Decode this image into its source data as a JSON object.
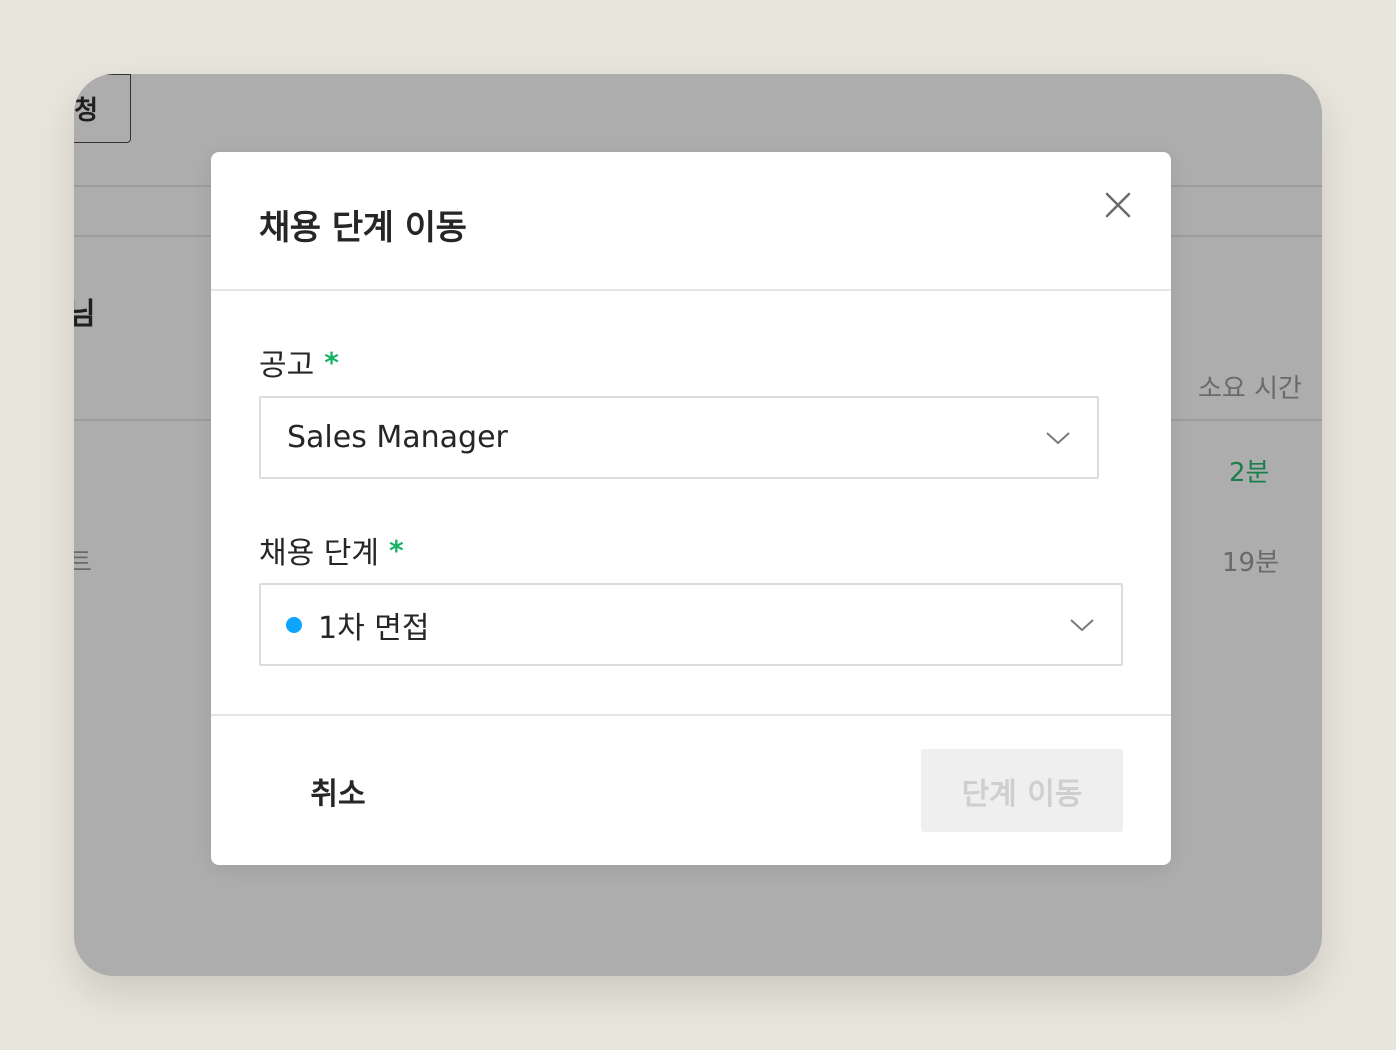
{
  "background": {
    "tab_fragment": "청",
    "heading_fragment": "님",
    "row_fragment": "트",
    "column_header": "소요 시간",
    "rows": [
      {
        "duration": "2분",
        "color": "#1b7f4c"
      },
      {
        "duration": "19분",
        "color": "#6a6a6a"
      }
    ]
  },
  "modal": {
    "title": "채용 단계 이동",
    "close_icon": "close-icon",
    "fields": {
      "posting": {
        "label": "공고",
        "required_mark": "*",
        "value": "Sales Manager"
      },
      "stage": {
        "label": "채용 단계",
        "required_mark": "*",
        "value": "1차 면접",
        "dot_color": "#0ea5ff"
      }
    },
    "footer": {
      "cancel_label": "취소",
      "submit_label": "단계 이동",
      "submit_disabled": true
    }
  },
  "colors": {
    "accent_required": "#16b364",
    "overlay": "#adadad"
  }
}
